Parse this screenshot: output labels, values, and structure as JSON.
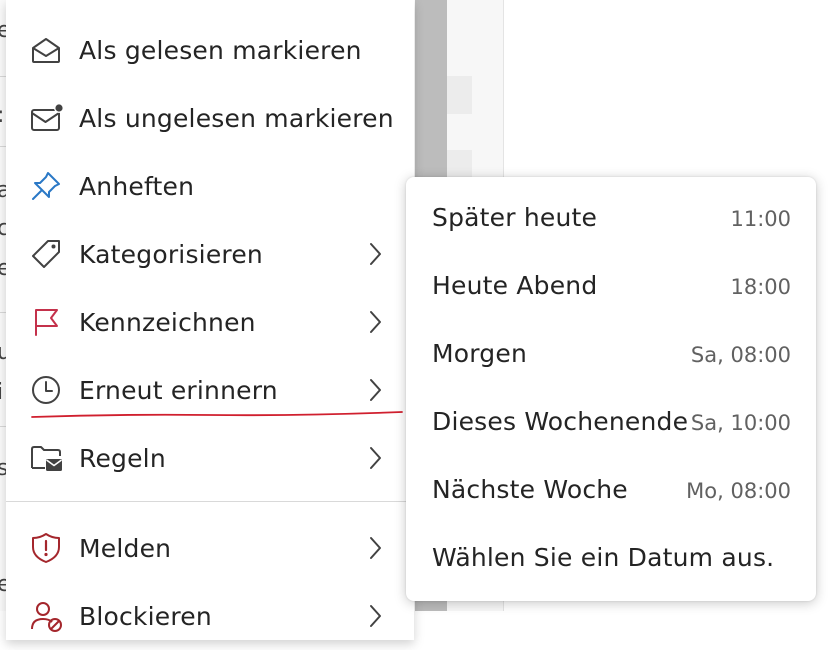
{
  "background": {
    "fragments": [
      "e",
      ":",
      "a",
      "c",
      "e",
      "u",
      "i",
      "s",
      "e",
      "e"
    ]
  },
  "context_menu": {
    "items": [
      {
        "label": "Als gelesen markieren",
        "icon": "envelope-open-icon",
        "has_submenu": false
      },
      {
        "label": "Als ungelesen markieren",
        "icon": "envelope-unread-icon",
        "has_submenu": false
      },
      {
        "label": "Anheften",
        "icon": "pin-icon",
        "has_submenu": false
      },
      {
        "label": "Kategorisieren",
        "icon": "tag-icon",
        "has_submenu": true
      },
      {
        "label": "Kennzeichnen",
        "icon": "flag-icon",
        "has_submenu": true
      },
      {
        "label": "Erneut erinnern",
        "icon": "clock-icon",
        "has_submenu": true,
        "expanded": true
      },
      {
        "label": "Regeln",
        "icon": "folder-mail-icon",
        "has_submenu": true
      },
      {
        "label": "Melden",
        "icon": "shield-alert-icon",
        "has_submenu": true
      },
      {
        "label": "Blockieren",
        "icon": "person-block-icon",
        "has_submenu": true
      }
    ],
    "accent_colors": {
      "pin": "#2a78c6",
      "flag": "#c4314b",
      "shield": "#a4262c",
      "underline": "#d01f2e"
    }
  },
  "snooze_submenu": {
    "items": [
      {
        "label": "Später heute",
        "time": "11:00"
      },
      {
        "label": "Heute Abend",
        "time": "18:00"
      },
      {
        "label": "Morgen",
        "time": "Sa, 08:00"
      },
      {
        "label": "Dieses Wochenende",
        "time": "Sa, 10:00"
      },
      {
        "label": "Nächste Woche",
        "time": "Mo, 08:00"
      },
      {
        "label": "Wählen Sie ein Datum aus.",
        "time": ""
      }
    ]
  }
}
